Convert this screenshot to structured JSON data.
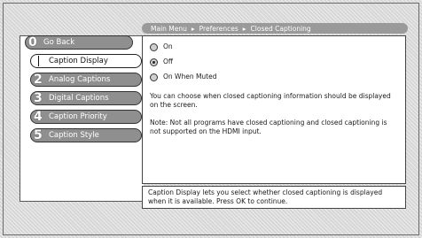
{
  "breadcrumb": {
    "items": [
      "Main Menu",
      "Preferences",
      "Closed Captioning"
    ],
    "separator": "▸"
  },
  "menu": {
    "items": [
      {
        "number": "0",
        "label": "Go Back"
      },
      {
        "number": "1",
        "label": "Caption Display",
        "selected": true
      },
      {
        "number": "2",
        "label": "Analog Captions"
      },
      {
        "number": "3",
        "label": "Digital Captions"
      },
      {
        "number": "4",
        "label": "Caption Priority"
      },
      {
        "number": "5",
        "label": "Caption Style"
      }
    ]
  },
  "options": [
    {
      "label": "On",
      "checked": false
    },
    {
      "label": "Off",
      "checked": true
    },
    {
      "label": "On When Muted",
      "checked": false
    }
  ],
  "content": {
    "description": "You can choose when closed captioning information should be displayed on the screen.",
    "note": "Note: Not all programs have closed captioning and closed captioning is not supported on the HDMI input."
  },
  "help": {
    "text": "Caption Display lets you select whether closed captioning is displayed when it is available. Press OK to continue."
  }
}
